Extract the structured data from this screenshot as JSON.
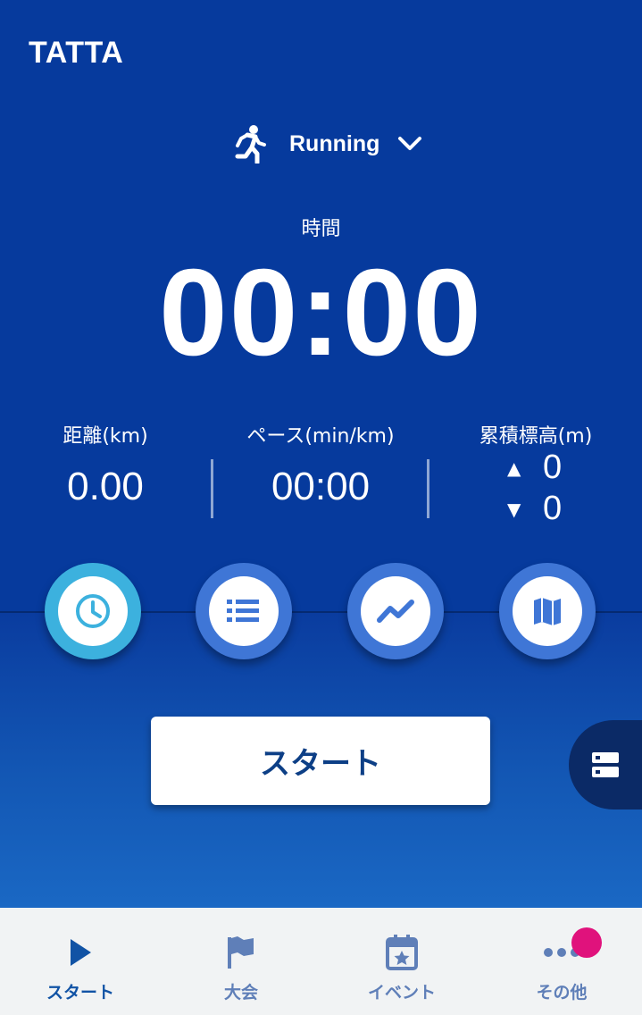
{
  "app": {
    "logo": "TATTA"
  },
  "activity": {
    "label": "Running"
  },
  "timer": {
    "label": "時間",
    "value": "00:00"
  },
  "stats": {
    "distance": {
      "label": "距離(km)",
      "value": "0.00"
    },
    "pace": {
      "label": "ペース(min/km)",
      "value": "00:00"
    },
    "elevation": {
      "label": "累積標高(m)",
      "up_arrow": "▲",
      "up": "0",
      "down_arrow": "▼",
      "down": "0"
    }
  },
  "mode_buttons": [
    {
      "icon": "clock-icon",
      "active": true
    },
    {
      "icon": "list-icon",
      "active": false
    },
    {
      "icon": "chart-line-icon",
      "active": false
    },
    {
      "icon": "map-icon",
      "active": false
    }
  ],
  "start_button": {
    "label": "スタート"
  },
  "tabs": [
    {
      "label": "スタート",
      "icon": "play-icon",
      "active": true
    },
    {
      "label": "大会",
      "icon": "flag-icon",
      "active": false
    },
    {
      "label": "イベント",
      "icon": "calendar-star-icon",
      "active": false
    },
    {
      "label": "その他",
      "icon": "more-dots-icon",
      "active": false
    }
  ],
  "colors": {
    "header_bg": "#063a9d",
    "active_circle": "#3cb1de",
    "circle": "#3f76d6",
    "start_text": "#0d3f86",
    "badge": "#e0127c"
  }
}
